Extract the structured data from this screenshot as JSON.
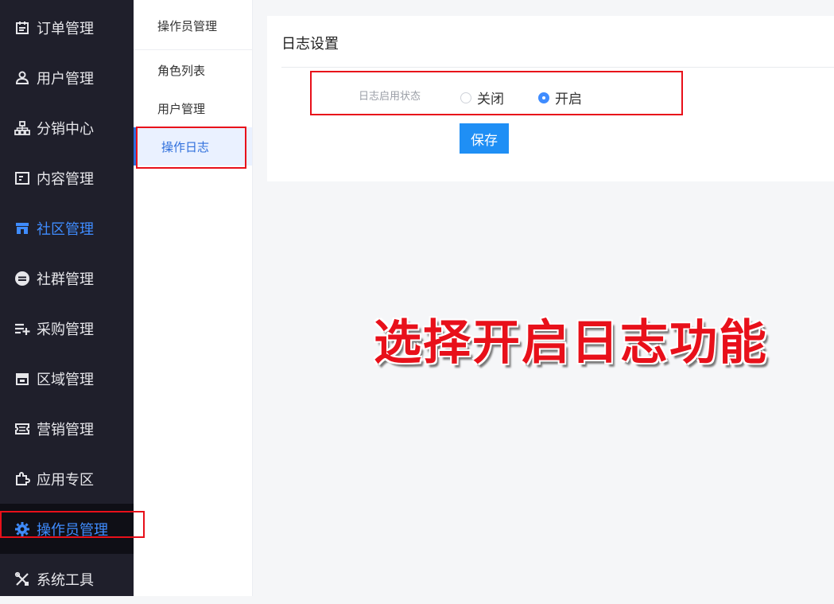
{
  "sidebar": {
    "items": [
      {
        "label": "订单管理",
        "icon": "calendar-icon"
      },
      {
        "label": "用户管理",
        "icon": "user-icon"
      },
      {
        "label": "分销中心",
        "icon": "org-chart-icon"
      },
      {
        "label": "内容管理",
        "icon": "card-icon"
      },
      {
        "label": "社区管理",
        "icon": "store-icon"
      },
      {
        "label": "社群管理",
        "icon": "minus-circle-icon"
      },
      {
        "label": "采购管理",
        "icon": "list-add-icon"
      },
      {
        "label": "区域管理",
        "icon": "shop-icon"
      },
      {
        "label": "营销管理",
        "icon": "ticket-icon"
      },
      {
        "label": "应用专区",
        "icon": "puzzle-icon"
      },
      {
        "label": "操作员管理",
        "icon": "gear-icon"
      },
      {
        "label": "系统工具",
        "icon": "tools-icon"
      }
    ]
  },
  "submenu": {
    "title": "操作员管理",
    "items": [
      {
        "label": "角色列表"
      },
      {
        "label": "用户管理"
      },
      {
        "label": "操作日志"
      }
    ]
  },
  "card": {
    "title": "日志设置",
    "form": {
      "label": "日志启用状态",
      "options": [
        {
          "label": "关闭",
          "checked": false
        },
        {
          "label": "开启",
          "checked": true
        }
      ],
      "save_label": "保存"
    }
  },
  "caption": "选择开启日志功能",
  "colors": {
    "sidebar_bg": "#1f1f2b",
    "accent": "#3f8cff",
    "button": "#1f8ff5",
    "annotation": "#e8101a"
  }
}
